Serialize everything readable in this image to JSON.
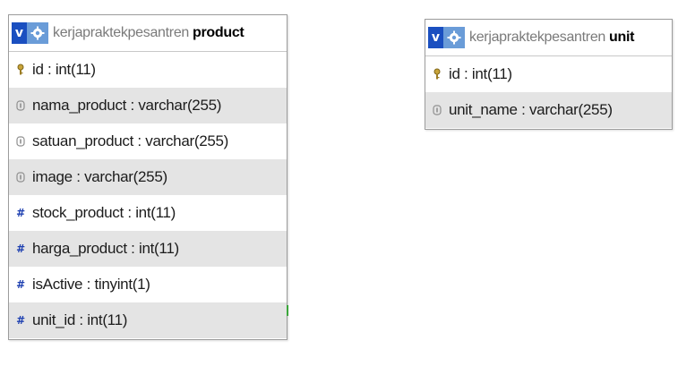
{
  "tables": {
    "product": {
      "database": "kerjapraktekpesantren",
      "name": "product",
      "columns": [
        {
          "label": "id : int(11)",
          "icon": "key-icon"
        },
        {
          "label": "nama_product : varchar(255)",
          "icon": "text-field-icon"
        },
        {
          "label": "satuan_product : varchar(255)",
          "icon": "text-field-icon"
        },
        {
          "label": "image : varchar(255)",
          "icon": "text-field-icon"
        },
        {
          "label": "stock_product : int(11)",
          "icon": "number-field-icon"
        },
        {
          "label": "harga_product : int(11)",
          "icon": "number-field-icon"
        },
        {
          "label": "isActive : tinyint(1)",
          "icon": "number-field-icon"
        },
        {
          "label": "unit_id : int(11)",
          "icon": "number-field-icon"
        }
      ]
    },
    "unit": {
      "database": "kerjapraktekpesantren",
      "name": "unit",
      "columns": [
        {
          "label": "id : int(11)",
          "icon": "key-icon"
        },
        {
          "label": "unit_name : varchar(255)",
          "icon": "text-field-icon"
        }
      ]
    }
  },
  "header_button_label": "v",
  "colors": {
    "v_button": "#1a4fc0",
    "gear_button": "#6a9cd8",
    "alt_row": "#e4e4e4",
    "number_icon": "#1d3fb0",
    "relation_line": "#3aa63a"
  }
}
